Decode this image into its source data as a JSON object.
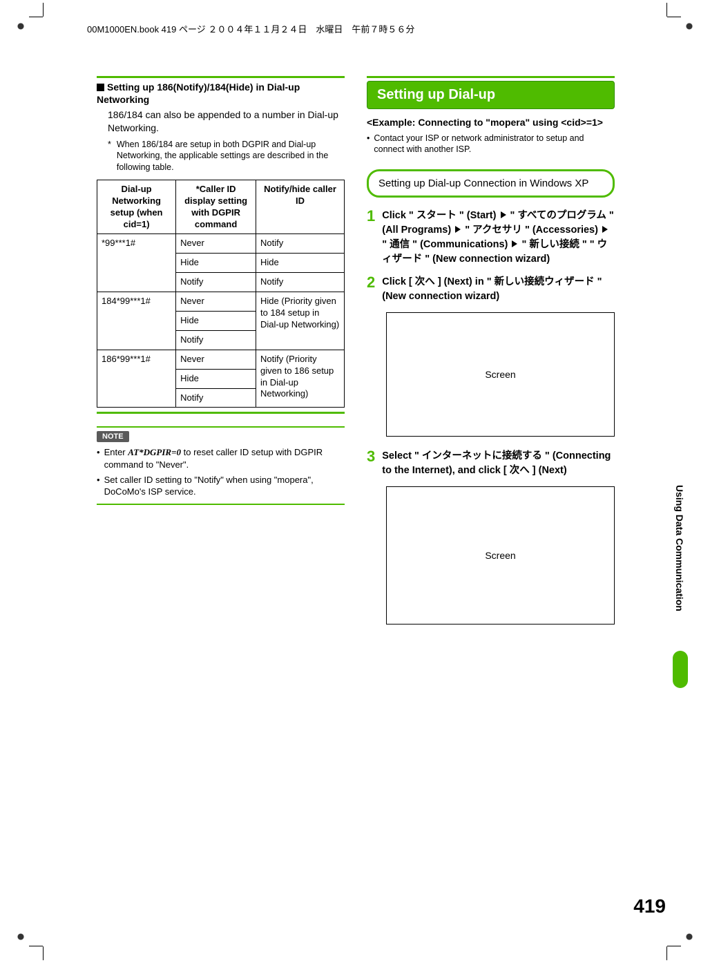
{
  "meta_line": "00M1000EN.book  419 ページ  ２００４年１１月２４日　水曜日　午前７時５６分",
  "left": {
    "sub_heading": "Setting up 186(Notify)/184(Hide) in Dial-up Networking",
    "sub_body": "186/184 can also be appended to a number in Dial-up Networking.",
    "footnote": "When 186/184 are setup in both DGPIR and Dial-up Networking, the applicable settings are described in the following table.",
    "table": {
      "h1": "Dial-up Networking setup (when cid=1)",
      "h2": "*Caller ID display setting with DGPIR command",
      "h3": "Notify/hide caller ID",
      "r1c1": "*99***1#",
      "r1c2": "Never",
      "r1c3": "Notify",
      "r2c2": "Hide",
      "r2c3": "Hide",
      "r3c2": "Notify",
      "r3c3": "Notify",
      "r4c1": "184*99***1#",
      "r4c2": "Never",
      "r4c3": "Hide (Priority given to 184 setup in Dial-up Networking)",
      "r5c2": "Hide",
      "r6c2": "Notify",
      "r7c1": "186*99***1#",
      "r7c2": "Never",
      "r7c3": "Notify (Priority given to 186 setup in Dial-up Networking)",
      "r8c2": "Hide",
      "r9c2": "Notify"
    },
    "note_label": "NOTE",
    "note1_pre": "Enter ",
    "note1_cmd": "AT*DGPIR=0",
    "note1_post": " to reset caller ID setup with DGPIR command to \"Never\".",
    "note2": "Set caller ID setting to \"Notify\" when using \"mopera\", DoCoMo's ISP service."
  },
  "right": {
    "big_heading": "Setting up Dial-up",
    "example": "<Example: Connecting to \"mopera\" using <cid>=1>",
    "example_bullet": "Contact your ISP or network administrator to setup and connect with another ISP.",
    "sub_box": "Setting up Dial-up Connection in Windows XP",
    "step1": {
      "num": "1",
      "p1": "Click \" スタート \" (Start)",
      "p2": "\" すべてのプログラム \" (All Programs)",
      "p3": "\" アクセサリ \" (Accessories)",
      "p4": "\" 通信 \" (Communications)",
      "p5": "\" 新しい接続 \" \" ウィザード \" (New connection wizard)"
    },
    "step2": {
      "num": "2",
      "txt": "Click [ 次へ ] (Next) in \" 新しい接続ウィザード \" (New connection wizard)",
      "screen": "Screen"
    },
    "step3": {
      "num": "3",
      "txt": "Select \" インターネットに接続する \" (Connecting to the Internet), and click [ 次へ ] (Next)",
      "screen": "Screen"
    }
  },
  "side_label": "Using Data Communication",
  "page_number": "419"
}
